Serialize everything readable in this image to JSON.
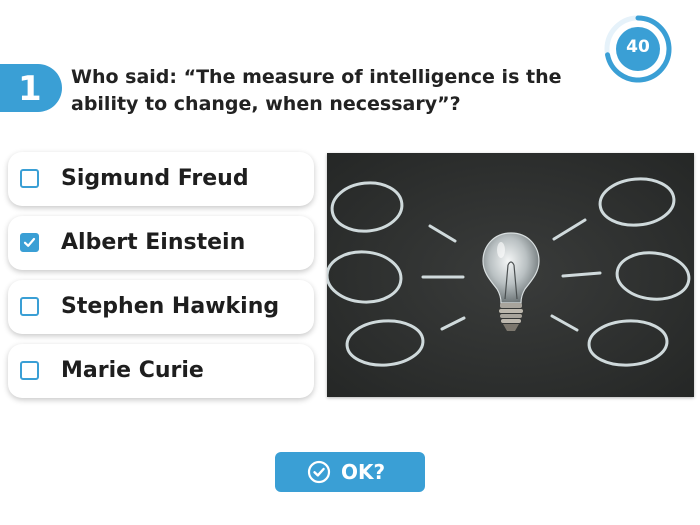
{
  "question": {
    "number": "1",
    "text": "Who said: “The measure of intelligence is the ability to change, when necessary”?"
  },
  "timer": {
    "value": "40",
    "remaining_fraction": 0.72,
    "color": "#3a9fd5"
  },
  "options": [
    {
      "label": "Sigmund Freud",
      "checked": false
    },
    {
      "label": "Albert Einstein",
      "checked": true
    },
    {
      "label": "Stephen Hawking",
      "checked": false
    },
    {
      "label": "Marie Curie",
      "checked": false
    }
  ],
  "image": {
    "subject": "light bulb on chalkboard with chalk circles",
    "icon": "lightbulb-chalkboard-image"
  },
  "submit": {
    "label": "OK?",
    "icon": "check-circle-icon"
  },
  "colors": {
    "accent": "#3a9fd5",
    "text": "#222222",
    "board": "#2d2f2e"
  }
}
